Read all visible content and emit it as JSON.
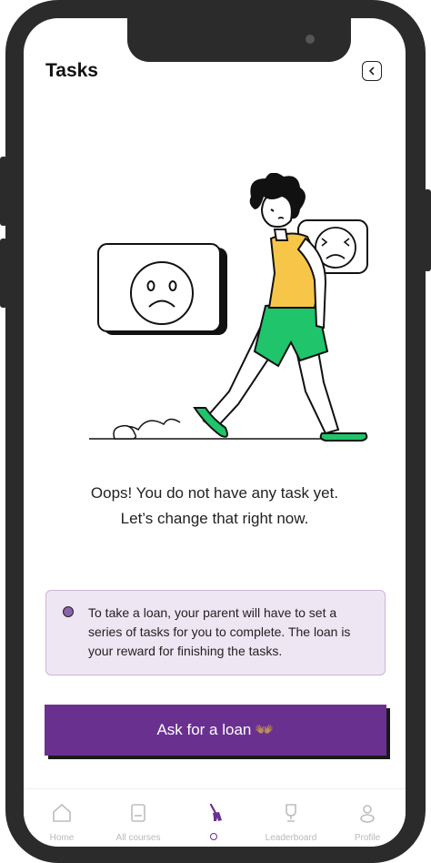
{
  "header": {
    "title": "Tasks",
    "back_icon": "chevron-left-icon"
  },
  "empty_state": {
    "line1": "Oops! You do not have any task yet.",
    "line2": "Let’s change that right now."
  },
  "info_box": {
    "text": "To take a loan, your parent will have to set a series of tasks for you to complete. The loan is your reward for finishing the tasks."
  },
  "cta": {
    "label": "Ask for a loan",
    "emoji": "👐🏽",
    "color": "#6a3090"
  },
  "nav": {
    "items": [
      {
        "label": "Home",
        "icon": "home-icon"
      },
      {
        "label": "All courses",
        "icon": "book-icon"
      },
      {
        "label": "",
        "icon": "broom-icon",
        "active": true
      },
      {
        "label": "Leaderboard",
        "icon": "trophy-icon"
      },
      {
        "label": "Profile",
        "icon": "profile-icon"
      }
    ]
  },
  "colors": {
    "accent": "#6a3090",
    "info_bg": "#efe6f4",
    "shirt": "#f7c648",
    "pants": "#1fc46b"
  }
}
